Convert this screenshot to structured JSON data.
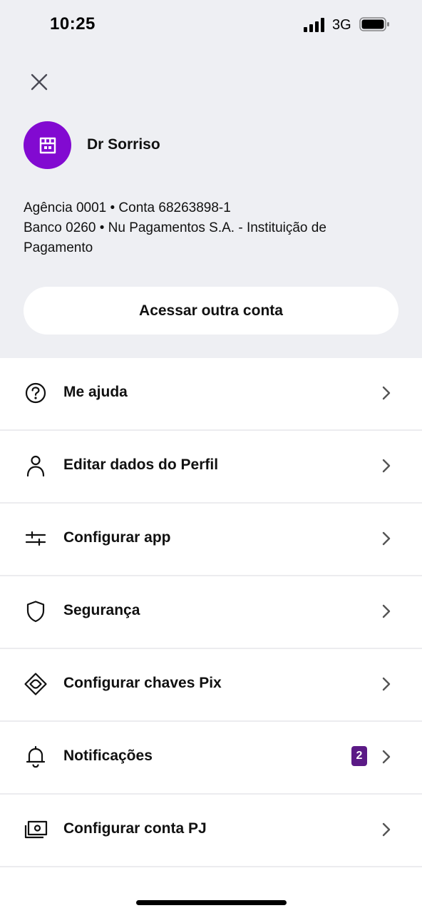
{
  "status_bar": {
    "time": "10:25",
    "network": "3G",
    "signal_icon": "cellular-signal-icon",
    "battery_icon": "battery-icon"
  },
  "header": {
    "close_icon": "close-icon",
    "avatar_icon": "store-icon",
    "profile_name": "Dr Sorriso",
    "account_line1": "Agência 0001 • Conta 68263898-1",
    "account_line2": "Banco 0260 • Nu Pagamentos S.A. - Instituição de",
    "account_line3": "Pagamento",
    "access_button_label": "Acessar outra conta"
  },
  "menu": {
    "items": [
      {
        "label": "Me ajuda",
        "icon": "help-circle-icon"
      },
      {
        "label": "Editar dados do Perfil",
        "icon": "user-icon"
      },
      {
        "label": "Configurar app",
        "icon": "sliders-icon"
      },
      {
        "label": "Segurança",
        "icon": "shield-icon"
      },
      {
        "label": "Configurar chaves Pix",
        "icon": "pix-icon"
      },
      {
        "label": "Notificações",
        "icon": "bell-icon",
        "badge": "2"
      },
      {
        "label": "Configurar conta PJ",
        "icon": "business-account-icon"
      }
    ]
  },
  "colors": {
    "brand_purple": "#820ad1",
    "badge_purple": "#5b1a86",
    "header_background": "#eeeff3",
    "divider": "#ececef"
  }
}
